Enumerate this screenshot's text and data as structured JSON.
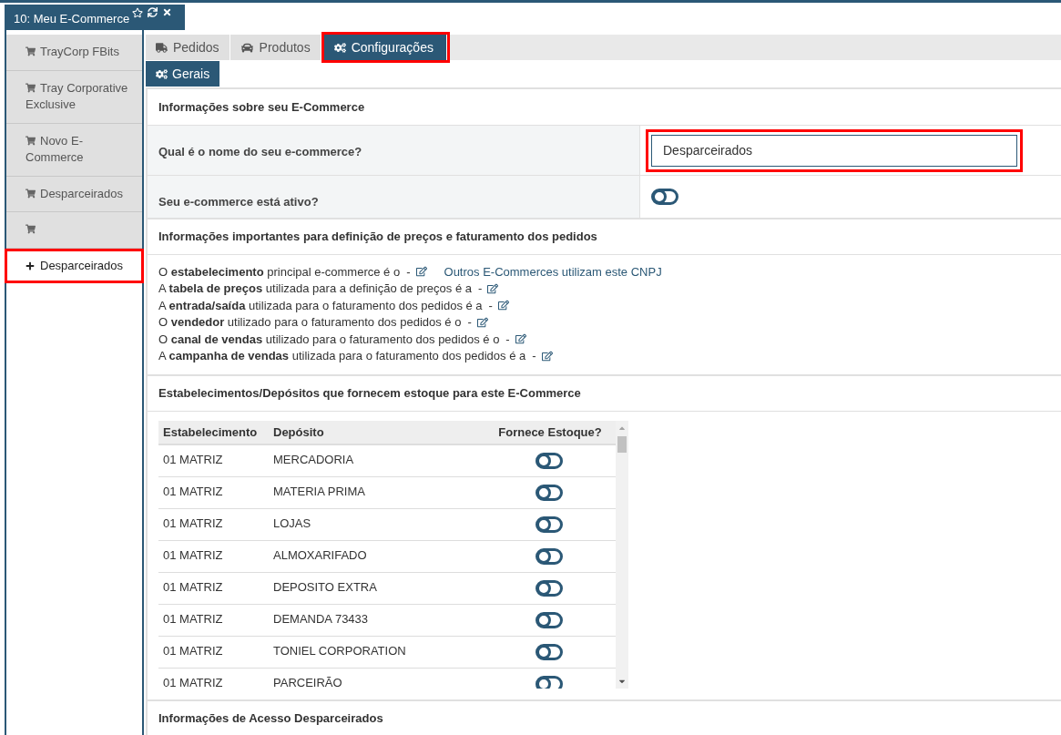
{
  "window_tab": {
    "title": "10: Meu E-Commerce"
  },
  "sidebar": {
    "items": [
      {
        "kind": "cart",
        "label": "TrayCorp FBits",
        "selected": false,
        "highlighted": false
      },
      {
        "kind": "cart",
        "label": "Tray Corporative Exclusive",
        "selected": false,
        "highlighted": false
      },
      {
        "kind": "cart",
        "label": "Novo E-Commerce",
        "selected": false,
        "highlighted": false
      },
      {
        "kind": "cart",
        "label": "Desparceirados",
        "selected": false,
        "highlighted": false
      },
      {
        "kind": "cart",
        "selected": false,
        "highlighted": false
      },
      {
        "kind": "add",
        "label": "Desparceirados",
        "selected": true,
        "highlighted": true
      }
    ]
  },
  "tabs": [
    {
      "kind": "truck",
      "label": "Pedidos",
      "selected": false,
      "highlighted": false
    },
    {
      "kind": "car",
      "label": "Produtos",
      "selected": false,
      "highlighted": false
    },
    {
      "kind": "cogs",
      "label": "Configurações",
      "selected": true,
      "highlighted": true
    }
  ],
  "subtabs": [
    {
      "kind": "cogs",
      "label": "Gerais",
      "selected": true
    }
  ],
  "sections": [
    {
      "kind": "form",
      "title": "Informações sobre seu E-Commerce",
      "rows": [
        {
          "kind": "text",
          "label": "Qual é o nome do seu e-commerce?",
          "value": "Desparceirados",
          "highlighted": true
        },
        {
          "kind": "toggle",
          "label": "Seu e-commerce está ativo?",
          "on": false
        }
      ]
    },
    {
      "kind": "lines",
      "title": "Informações importantes para definição de preços e faturamento dos pedidos",
      "lines": [
        {
          "text": "O **estabelecimento** principal e-commerce é o",
          "value": "-",
          "link": "Outros E-Commerces utilizam este CNPJ"
        },
        {
          "text": "A **tabela de preços** utilizada para a definição de preços é a",
          "value": "-"
        },
        {
          "text": "A **entrada/saída** utilizada para o faturamento dos pedidos é a",
          "value": "-"
        },
        {
          "text": "O **vendedor** utilizado para o faturamento dos pedidos é o",
          "value": "-"
        },
        {
          "text": "O **canal de vendas** utilizado para o faturamento dos pedidos é o",
          "value": "-"
        },
        {
          "text": "A **campanha de vendas** utilizada para o faturamento dos pedidos é a",
          "value": "-"
        }
      ]
    },
    {
      "kind": "table",
      "title": "Estabelecimentos/Depósitos que fornecem estoque para este E-Commerce",
      "columns": [
        "Estabelecimento",
        "Depósito",
        "Fornece Estoque?"
      ],
      "rows": [
        {
          "estabelecimento": "01 MATRIZ",
          "deposito": "MERCADORIA",
          "on": false
        },
        {
          "estabelecimento": "01 MATRIZ",
          "deposito": "MATERIA PRIMA",
          "on": false
        },
        {
          "estabelecimento": "01 MATRIZ",
          "deposito": "LOJAS",
          "on": false
        },
        {
          "estabelecimento": "01 MATRIZ",
          "deposito": "ALMOXARIFADO",
          "on": false
        },
        {
          "estabelecimento": "01 MATRIZ",
          "deposito": "DEPOSITO EXTRA",
          "on": false
        },
        {
          "estabelecimento": "01 MATRIZ",
          "deposito": "DEMANDA 73433",
          "on": false
        },
        {
          "estabelecimento": "01 MATRIZ",
          "deposito": "TONIEL CORPORATION",
          "on": false
        },
        {
          "estabelecimento": "01 MATRIZ",
          "deposito": "PARCEIRÃO",
          "on": false
        }
      ]
    },
    {
      "kind": "heading",
      "title": "Informações de Acesso Desparceirados"
    }
  ]
}
